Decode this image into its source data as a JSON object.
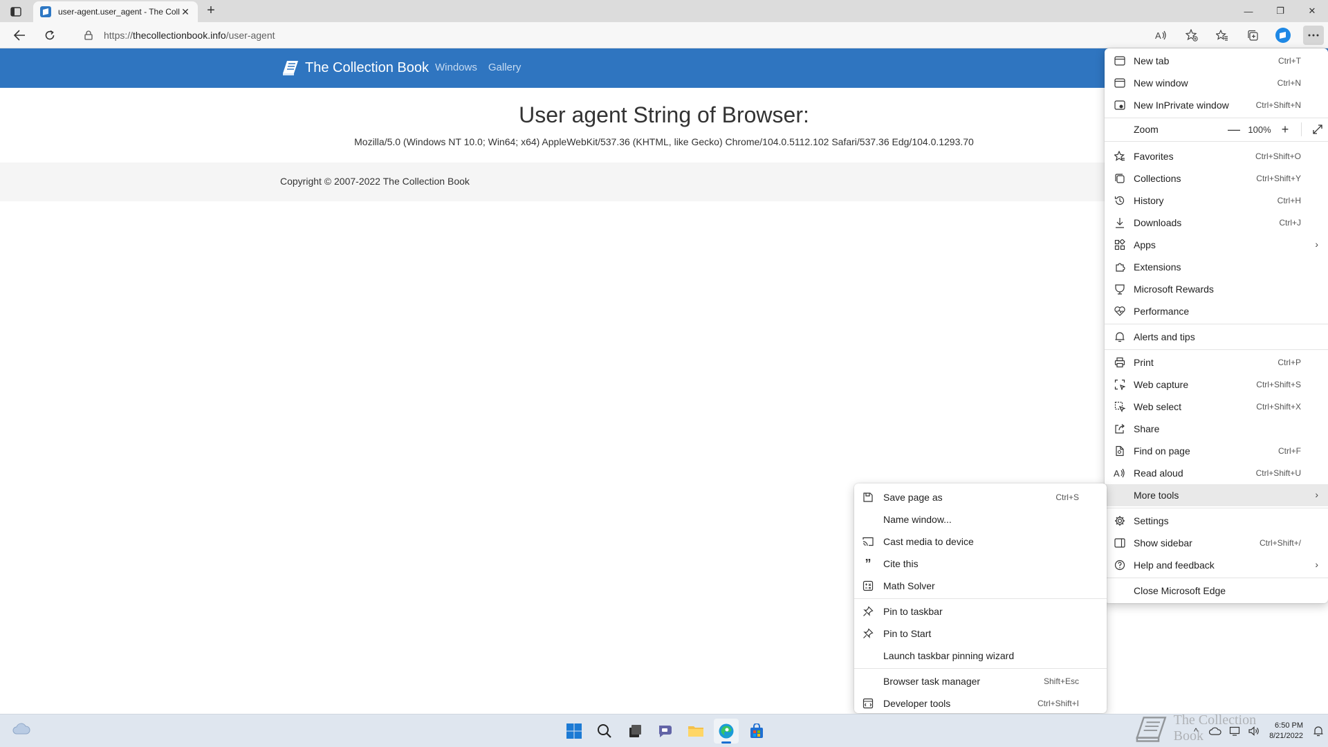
{
  "tab": {
    "title": "user-agent.user_agent - The Coll",
    "close": "✕",
    "new_tab": "+"
  },
  "window_controls": {
    "minimize": "—",
    "restore": "❐",
    "close": "✕"
  },
  "address": {
    "protocol": "https://",
    "host": "thecollectionbook.info",
    "path": "/user-agent"
  },
  "site": {
    "brand": "The Collection Book",
    "nav": [
      "Windows",
      "Gallery"
    ],
    "title": "User agent String of Browser:",
    "ua": "Mozilla/5.0 (Windows NT 10.0; Win64; x64) AppleWebKit/537.36 (KHTML, like Gecko) Chrome/104.0.5112.102 Safari/537.36 Edg/104.0.1293.70",
    "footer": "Copyright © 2007-2022 The Collection Book"
  },
  "menu": {
    "new_tab": {
      "label": "New tab",
      "shortcut": "Ctrl+T"
    },
    "new_window": {
      "label": "New window",
      "shortcut": "Ctrl+N"
    },
    "new_inprivate": {
      "label": "New InPrivate window",
      "shortcut": "Ctrl+Shift+N"
    },
    "zoom": {
      "label": "Zoom",
      "value": "100%",
      "minus": "—",
      "plus": "+"
    },
    "favorites": {
      "label": "Favorites",
      "shortcut": "Ctrl+Shift+O"
    },
    "collections": {
      "label": "Collections",
      "shortcut": "Ctrl+Shift+Y"
    },
    "history": {
      "label": "History",
      "shortcut": "Ctrl+H"
    },
    "downloads": {
      "label": "Downloads",
      "shortcut": "Ctrl+J"
    },
    "apps": {
      "label": "Apps"
    },
    "extensions": {
      "label": "Extensions"
    },
    "rewards": {
      "label": "Microsoft Rewards"
    },
    "performance": {
      "label": "Performance"
    },
    "alerts": {
      "label": "Alerts and tips"
    },
    "print": {
      "label": "Print",
      "shortcut": "Ctrl+P"
    },
    "web_capture": {
      "label": "Web capture",
      "shortcut": "Ctrl+Shift+S"
    },
    "web_select": {
      "label": "Web select",
      "shortcut": "Ctrl+Shift+X"
    },
    "share": {
      "label": "Share"
    },
    "find": {
      "label": "Find on page",
      "shortcut": "Ctrl+F"
    },
    "read_aloud": {
      "label": "Read aloud",
      "shortcut": "Ctrl+Shift+U"
    },
    "more_tools": {
      "label": "More tools"
    },
    "settings": {
      "label": "Settings"
    },
    "show_sidebar": {
      "label": "Show sidebar",
      "shortcut": "Ctrl+Shift+/"
    },
    "help": {
      "label": "Help and feedback"
    },
    "close_edge": {
      "label": "Close Microsoft Edge"
    }
  },
  "submenu": {
    "save_page": {
      "label": "Save page as",
      "shortcut": "Ctrl+S"
    },
    "name_window": {
      "label": "Name window..."
    },
    "cast": {
      "label": "Cast media to device"
    },
    "cite": {
      "label": "Cite this"
    },
    "math": {
      "label": "Math Solver"
    },
    "pin_taskbar": {
      "label": "Pin to taskbar"
    },
    "pin_start": {
      "label": "Pin to Start"
    },
    "pin_wizard": {
      "label": "Launch taskbar pinning wizard"
    },
    "task_manager": {
      "label": "Browser task manager",
      "shortcut": "Shift+Esc"
    },
    "dev_tools": {
      "label": "Developer tools",
      "shortcut": "Ctrl+Shift+I"
    }
  },
  "taskbar": {
    "time": "6:50 PM",
    "date": "8/21/2022",
    "watermark": "The Collection Book"
  },
  "colors": {
    "header_blue": "#2f75c0",
    "edge_accent": "#1a6fd1"
  }
}
